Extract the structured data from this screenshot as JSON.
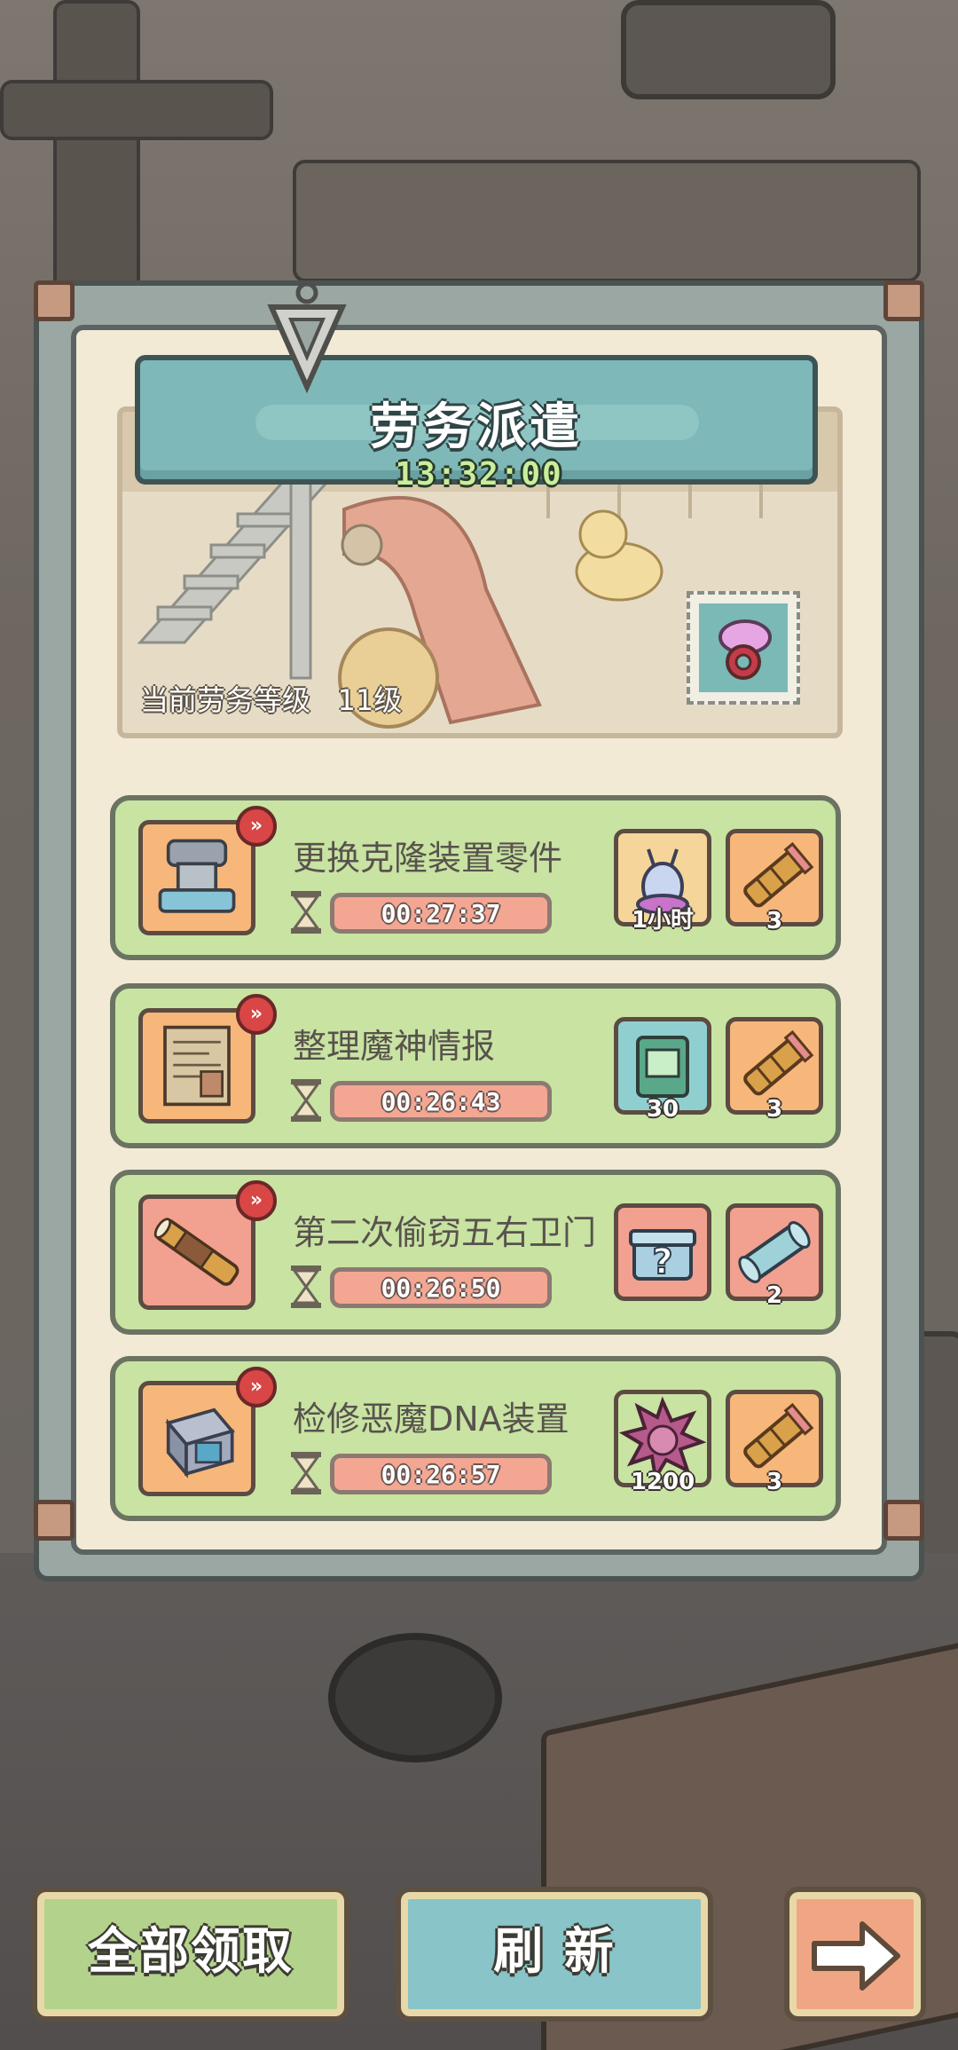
{
  "panel": {
    "title": "劳务派遣",
    "countdown": "13:32:00",
    "level_label": "当前劳务等级",
    "level_value": "11级"
  },
  "tasks": [
    {
      "name": "更换克隆装置零件",
      "time": "00:27:37",
      "icon": "clone-device-part-icon",
      "icon_bg": "#f7b77a",
      "rewards": [
        {
          "icon": "slug-icon",
          "qty": "1小时",
          "bg": "#f5d59a"
        },
        {
          "icon": "brass-telescope-icon",
          "qty": "3",
          "bg": "#f7b77a"
        }
      ]
    },
    {
      "name": "整理魔神情报",
      "time": "00:26:43",
      "icon": "intel-scroll-icon",
      "icon_bg": "#f7b77a",
      "rewards": [
        {
          "icon": "card-pack-icon",
          "qty": "30",
          "bg": "#8fcfcf"
        },
        {
          "icon": "brass-telescope-icon",
          "qty": "3",
          "bg": "#f7b77a"
        }
      ]
    },
    {
      "name": "第二次偷窃五右卫门",
      "time": "00:26:50",
      "icon": "spyglass-icon",
      "icon_bg": "#f2a08f",
      "rewards": [
        {
          "icon": "mystery-chest-icon",
          "qty": "",
          "bg": "#f2a08f"
        },
        {
          "icon": "blueprint-scroll-icon",
          "qty": "2",
          "bg": "#f2a08f"
        }
      ]
    },
    {
      "name": "检修恶魔DNA装置",
      "time": "00:26:57",
      "icon": "dna-device-icon",
      "icon_bg": "#f7b77a",
      "rewards": [
        {
          "icon": "spiky-orb-icon",
          "qty": "1200",
          "bg": "#c8e3a2"
        },
        {
          "icon": "brass-telescope-icon",
          "qty": "3",
          "bg": "#f7b77a"
        }
      ]
    }
  ],
  "buttons": {
    "claim_all": "全部领取",
    "refresh": "刷 新"
  },
  "colors": {
    "panel_bg": "#f3ead6",
    "banner": "#7fb8b8",
    "task_bg": "#c8e3a2",
    "timer_bar": "#f3a793",
    "badge": "#d84646"
  }
}
